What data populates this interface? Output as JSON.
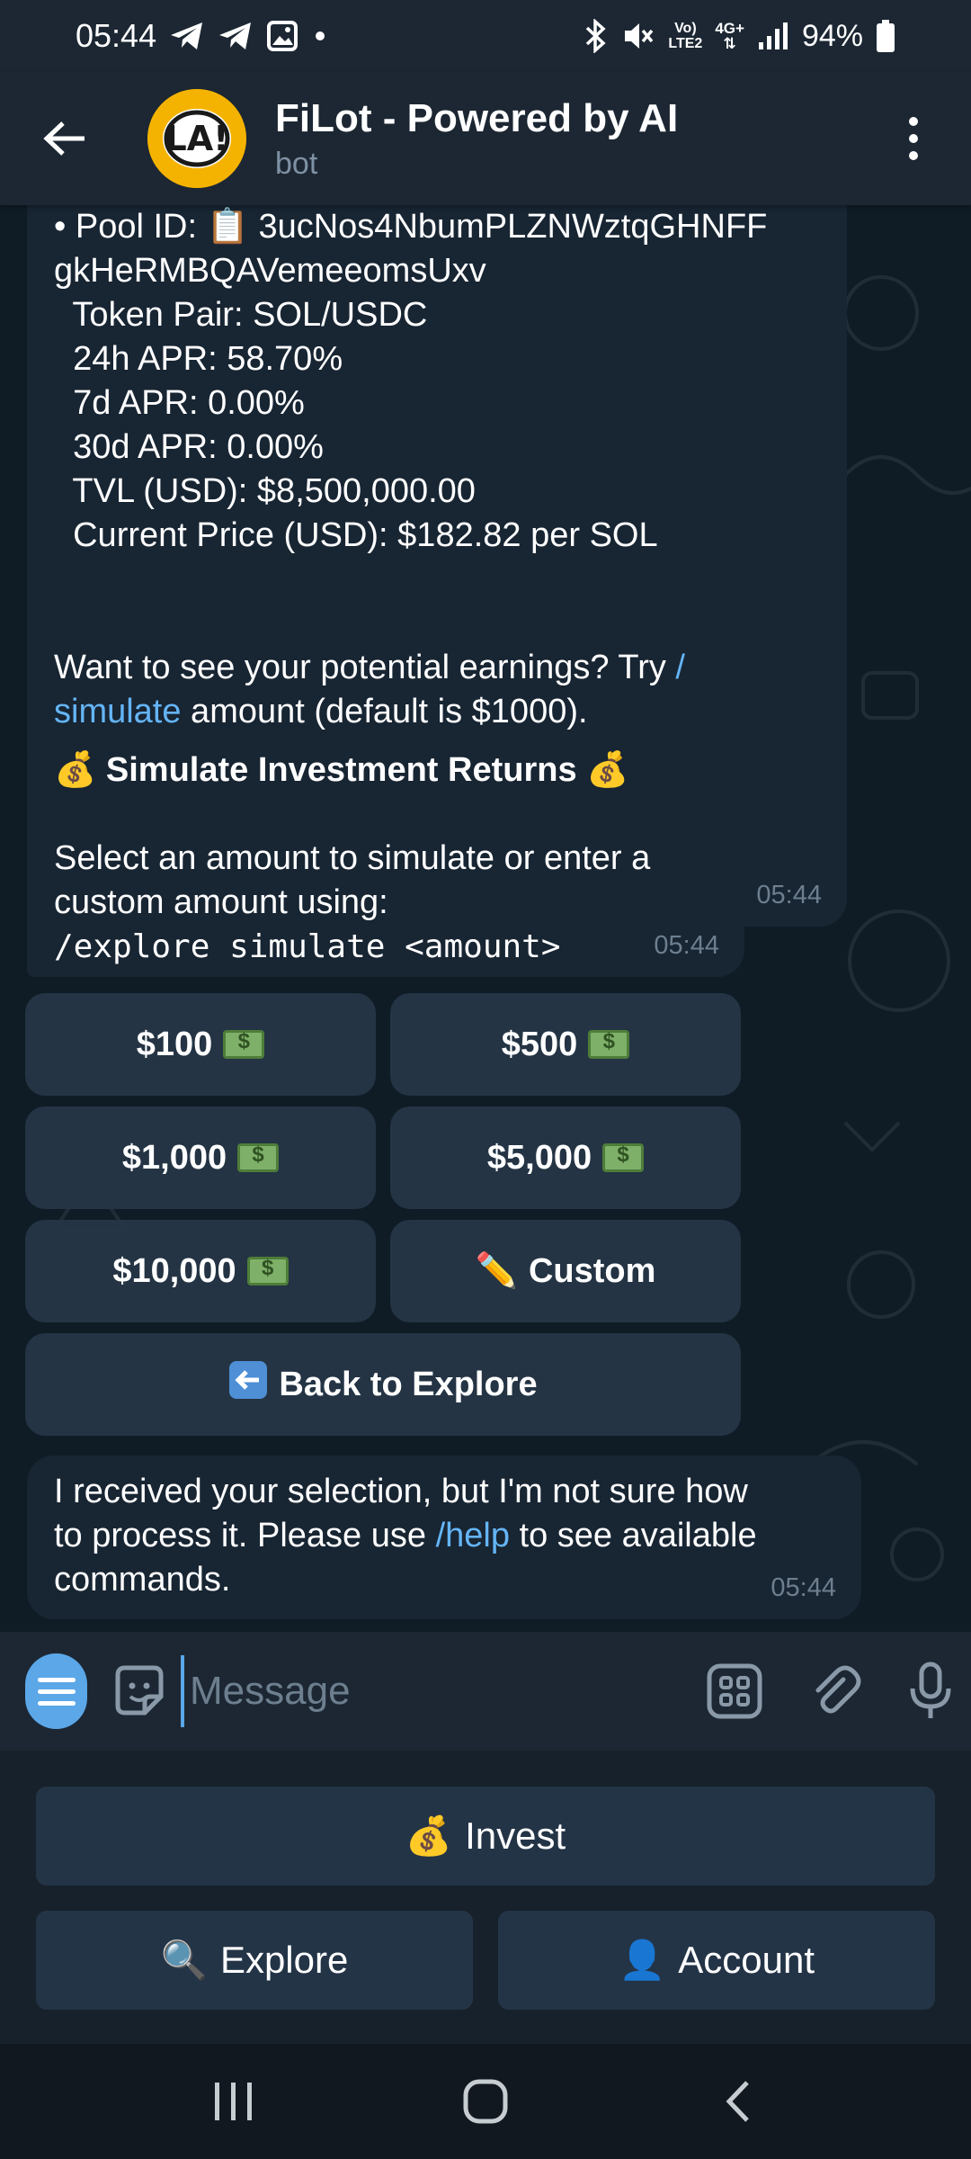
{
  "status_bar": {
    "time": "05:44",
    "network_top": "Vo)",
    "network_bottom": "LTE2",
    "data_type": "4G+",
    "battery": "94%"
  },
  "header": {
    "title": "FiLot - Powered by AI",
    "subtitle": "bot",
    "avatar_text": "LA!"
  },
  "messages": {
    "pool": {
      "lines": [
        "• Pool ID: 📋 3ucNos4NbumPLZNWztqGHNFF",
        "gkHeRMBQAVemeeomsUxv",
        "  Token Pair: SOL/USDC",
        "  24h APR: 58.70%",
        "  7d APR: 0.00%",
        "  30d APR: 0.00%",
        "  TVL (USD): $8,500,000.00",
        "  Current Price (USD): $182.82 per SOL"
      ],
      "prompt_a": "Want to see your potential earnings? Try ",
      "link_a": "/",
      "link_b": "simulate",
      "prompt_b": " amount (default is $1000).",
      "time": "05:44"
    },
    "simulate": {
      "title": "Simulate Investment Returns",
      "line1": "Select an amount to simulate or enter a",
      "line2": "custom amount using:",
      "command": "/explore simulate <amount>",
      "time": "05:44"
    },
    "unknown": {
      "line1": "I received your selection, but I'm not sure how",
      "line2_a": "to process it. Please use ",
      "line2_link": "/help",
      "line2_b": " to see available",
      "line3": "commands.",
      "time": "05:44"
    }
  },
  "inline_buttons": {
    "b100": "$100",
    "b500": "$500",
    "b1000": "$1,000",
    "b5000": "$5,000",
    "b10000": "$10,000",
    "custom": "Custom",
    "back": "Back to Explore"
  },
  "input": {
    "placeholder": "Message"
  },
  "reply_keyboard": {
    "invest": "Invest",
    "explore": "Explore",
    "account": "Account"
  },
  "colors": {
    "accent": "#5ba7e8",
    "link": "#64b5f6",
    "bubble": "#182533",
    "header": "#1c2733"
  }
}
